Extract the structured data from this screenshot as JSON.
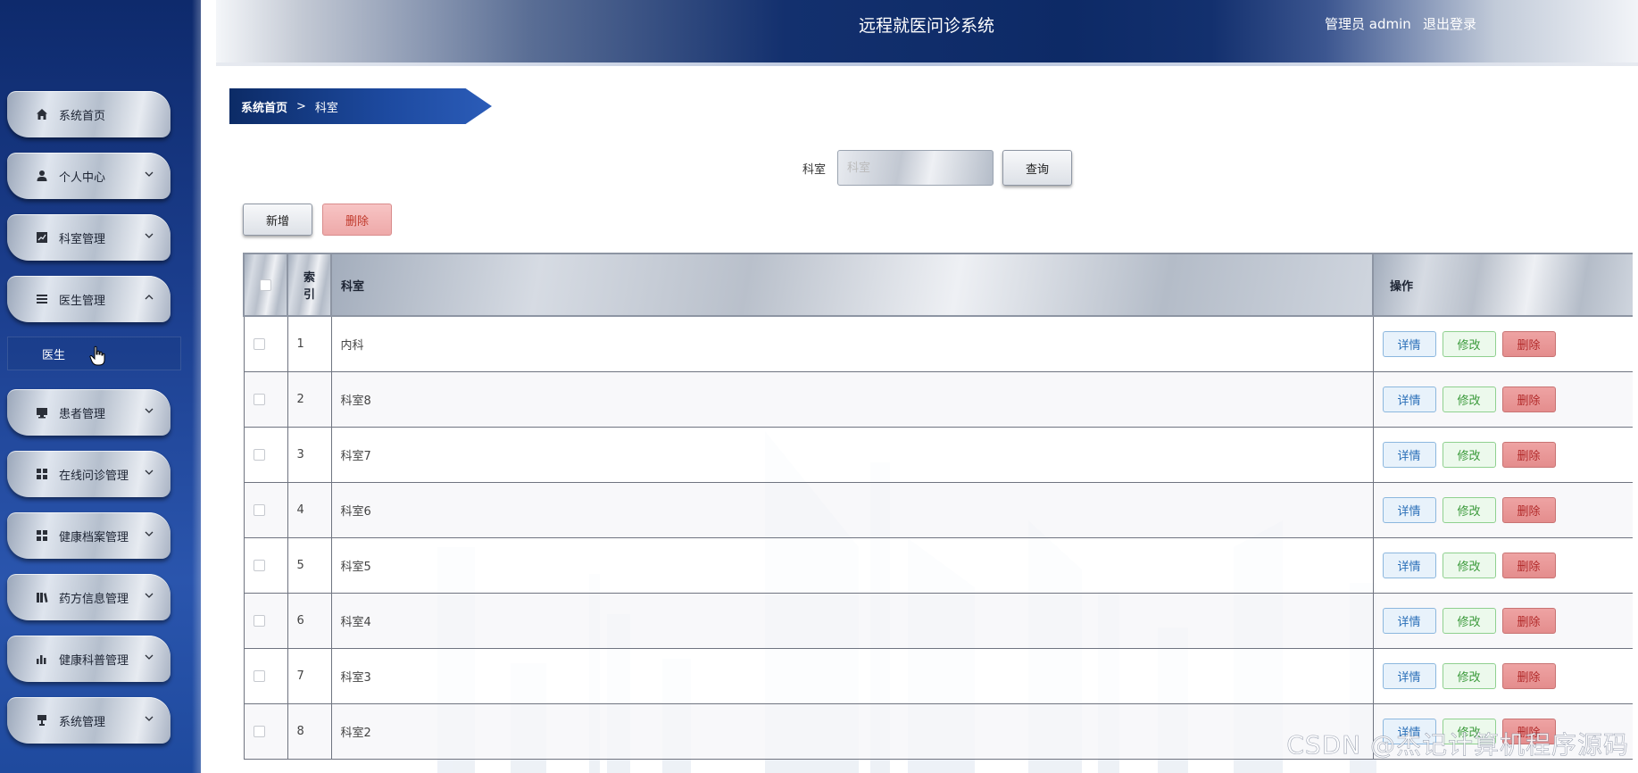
{
  "header": {
    "title": "远程就医问诊系统",
    "user": "管理员 admin",
    "logout": "退出登录"
  },
  "sidebar": {
    "items": [
      {
        "label": "系统首页",
        "icon": "home-icon",
        "arrow": "none"
      },
      {
        "label": "个人中心",
        "icon": "user-icon",
        "arrow": "down"
      },
      {
        "label": "科室管理",
        "icon": "chart-line-icon",
        "arrow": "down"
      },
      {
        "label": "医生管理",
        "icon": "list-icon",
        "arrow": "up"
      },
      {
        "label": "患者管理",
        "icon": "monitor-icon",
        "arrow": "down"
      },
      {
        "label": "在线问诊管理",
        "icon": "grid-icon",
        "arrow": "down"
      },
      {
        "label": "健康档案管理",
        "icon": "grid-icon",
        "arrow": "down"
      },
      {
        "label": "药方信息管理",
        "icon": "books-icon",
        "arrow": "down"
      },
      {
        "label": "健康科普管理",
        "icon": "bar-chart-icon",
        "arrow": "down"
      },
      {
        "label": "系统管理",
        "icon": "settings-icon",
        "arrow": "down"
      }
    ],
    "submenu": {
      "label": "医生"
    }
  },
  "breadcrumb": {
    "home": "系统首页",
    "separator": ">",
    "current": "科室"
  },
  "search": {
    "label": "科室",
    "placeholder": "科室",
    "button": "查询"
  },
  "actions": {
    "add": "新增",
    "delete": "删除"
  },
  "table": {
    "columns": {
      "index": "索引",
      "name": "科室",
      "ops": "操作"
    },
    "rows": [
      {
        "index": "1",
        "name": "内科"
      },
      {
        "index": "2",
        "name": "科室8"
      },
      {
        "index": "3",
        "name": "科室7"
      },
      {
        "index": "4",
        "name": "科室6"
      },
      {
        "index": "5",
        "name": "科室5"
      },
      {
        "index": "6",
        "name": "科室4"
      },
      {
        "index": "7",
        "name": "科室3"
      },
      {
        "index": "8",
        "name": "科室2"
      }
    ],
    "row_actions": {
      "detail": "详情",
      "edit": "修改",
      "delete": "删除"
    }
  },
  "watermark": "CSDN @杰记计算机程序源码",
  "colors": {
    "sidebar": "#1c3f8f",
    "header_dark": "#0d2a66",
    "detail_btn": "#2a6fb8",
    "edit_btn": "#3b9a3b",
    "delete_btn": "#b22a2a"
  }
}
